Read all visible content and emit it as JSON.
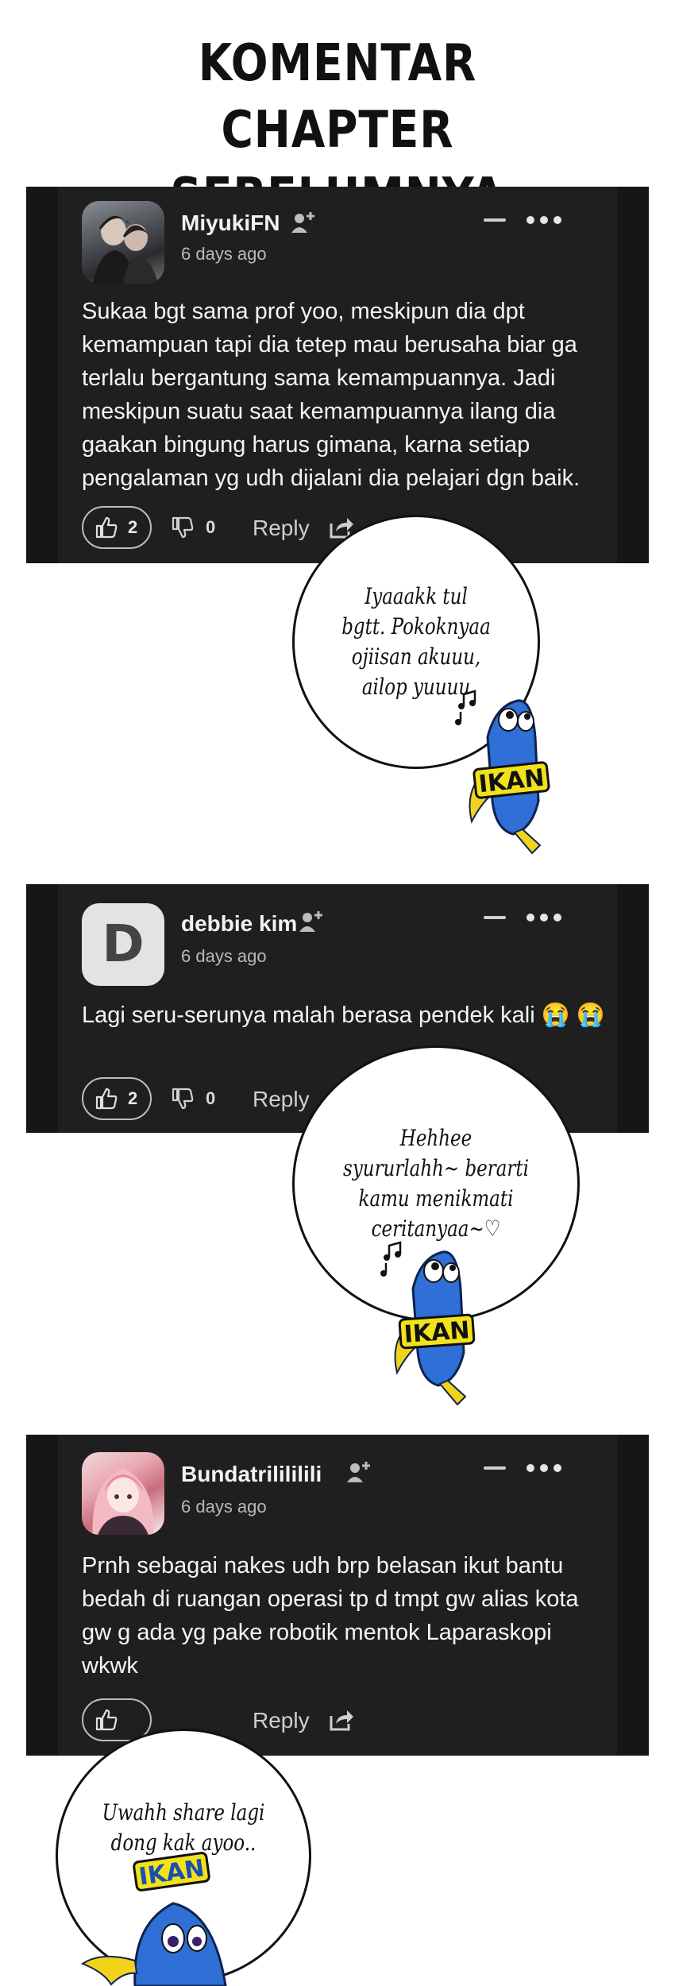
{
  "title": {
    "line1": "KOMENTAR",
    "line2": "CHAPTER SEBELUMNYA"
  },
  "colors": {
    "card_bg": "#1f1f1f",
    "card_edge": "#161616",
    "text": "#f2f2f2",
    "muted": "#b9b9b9",
    "mascot_blue": "#2f6fd6",
    "mascot_yellow": "#f2d21b"
  },
  "comments": [
    {
      "username": "MiyukiFN",
      "avatar": "photo",
      "timestamp": "6 days ago",
      "text": "Sukaa bgt sama prof yoo, meskipun dia dpt kemampuan tapi dia tetep mau berusaha biar ga terlalu bergantung sama kemampuannya. Jadi meskipun suatu saat kemampuannya ilang dia gaakan bingung harus gimana, karna setiap pengalaman yg udh dijalani dia pelajari dgn baik.",
      "likes": "2",
      "dislikes": "0",
      "reply_label": "Reply"
    },
    {
      "username": "debbie kim",
      "avatar": "D",
      "timestamp": "6 days ago",
      "text": "Lagi seru-serunya malah berasa pendek kali 😭 😭",
      "likes": "2",
      "dislikes": "0",
      "reply_label": "Reply"
    },
    {
      "username": "Bundatrilililili",
      "avatar": "photo",
      "timestamp": "6 days ago",
      "text": "Prnh sebagai nakes udh brp belasan ikut bantu bedah di ruangan operasi tp d tmpt gw alias kota gw g ada yg pake robotik mentok Laparaskopi wkwk",
      "reply_label": "Reply"
    }
  ],
  "bubbles": [
    {
      "text": "Iyaaakk tul bgtt. Pokoknyaa ojiisan akuuu, ailop yuuuu"
    },
    {
      "text": "Hehhee syururlahh~ berarti kamu menikmati ceritanyaa~♡"
    },
    {
      "text": "Uwahh share lagi dong kak ayoo.."
    }
  ],
  "mascot": {
    "label": "IKAN",
    "icons": [
      "music-notes-icon",
      "fish-icon"
    ]
  }
}
